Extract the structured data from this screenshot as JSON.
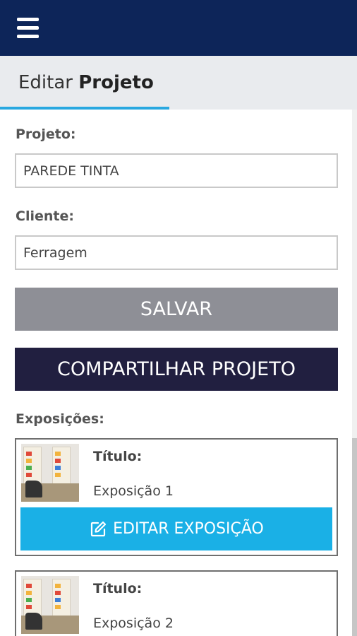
{
  "header": {
    "title_prefix": "Editar",
    "title_bold": "Projeto"
  },
  "form": {
    "project_label": "Projeto:",
    "project_value": "PAREDE TINTA",
    "client_label": "Cliente:",
    "client_value": "Ferragem"
  },
  "actions": {
    "save_label": "SALVAR",
    "share_label": "COMPARTILHAR PROJETO"
  },
  "expositions": {
    "section_label": "Exposições:",
    "items": [
      {
        "title_label": "Título:",
        "title": "Exposição 1",
        "edit_label": "EDITAR EXPOSIÇÃO"
      },
      {
        "title_label": "Título:",
        "title": "Exposição 2"
      }
    ]
  },
  "colors": {
    "topbar": "#0d2559",
    "accent": "#29a8e0",
    "save_button": "#8e8f96",
    "share_button": "#211f40",
    "edit_button": "#1ab0e6"
  },
  "icons": {
    "menu": "hamburger-icon",
    "edit": "edit-icon"
  }
}
